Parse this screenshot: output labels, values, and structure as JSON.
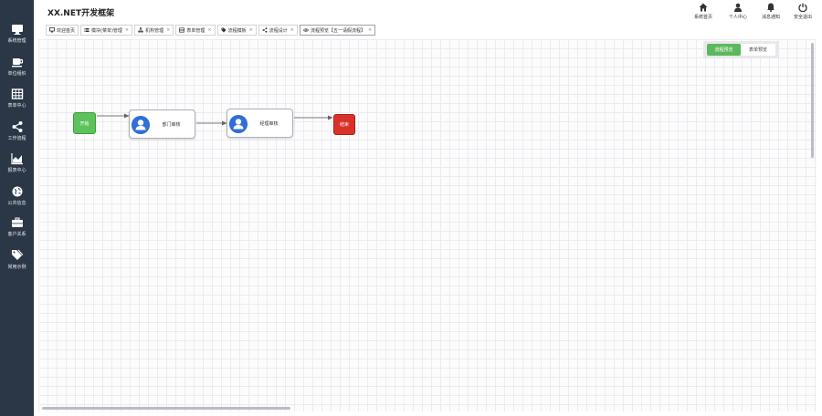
{
  "app": {
    "title": "XX.NET开发框架"
  },
  "sidebar": {
    "items": [
      {
        "label": "系统管理",
        "icon": "monitor-icon"
      },
      {
        "label": "单位组织",
        "icon": "coffee-cup-icon"
      },
      {
        "label": "表单中心",
        "icon": "table-icon"
      },
      {
        "label": "工作流程",
        "icon": "share-icon"
      },
      {
        "label": "报表中心",
        "icon": "area-chart-icon"
      },
      {
        "label": "公共信息",
        "icon": "globe-icon"
      },
      {
        "label": "客户关系",
        "icon": "briefcase-icon"
      },
      {
        "label": "常用示例",
        "icon": "tags-icon"
      }
    ]
  },
  "header": {
    "actions": [
      {
        "label": "系统首页",
        "icon": "home-icon"
      },
      {
        "label": "个人中心",
        "icon": "user-icon"
      },
      {
        "label": "消息通知",
        "icon": "bell-icon"
      },
      {
        "label": "安全退出",
        "icon": "power-icon"
      }
    ]
  },
  "tabs": [
    {
      "label": "欢迎首页",
      "icon": "monitor-icon",
      "closable": false
    },
    {
      "label": "模块(菜单)管理",
      "icon": "list-icon",
      "closable": true
    },
    {
      "label": "机构管理",
      "icon": "sitemap-icon",
      "closable": true
    },
    {
      "label": "表单管理",
      "icon": "table-icon",
      "closable": true
    },
    {
      "label": "流程模板",
      "icon": "tag-icon",
      "closable": true
    },
    {
      "label": "流程设计",
      "icon": "share-icon",
      "closable": true
    },
    {
      "label": "流程预览【五一请假流程】",
      "icon": "eye-icon",
      "closable": true,
      "active": true
    }
  ],
  "tab_close_glyph": "×",
  "toggle": {
    "options": [
      "流程预览",
      "表单预览"
    ],
    "selected": "流程预览"
  },
  "flow": {
    "start_label": "开始",
    "end_label": "结束",
    "tasks": [
      {
        "label": "部门审核"
      },
      {
        "label": "经理审核"
      }
    ]
  },
  "colors": {
    "sidebar_bg": "#2b3647",
    "start_node": "#5cc35c",
    "end_node": "#d9312a",
    "avatar": "#2f6fd6",
    "toggle_active": "#5cb85c"
  }
}
